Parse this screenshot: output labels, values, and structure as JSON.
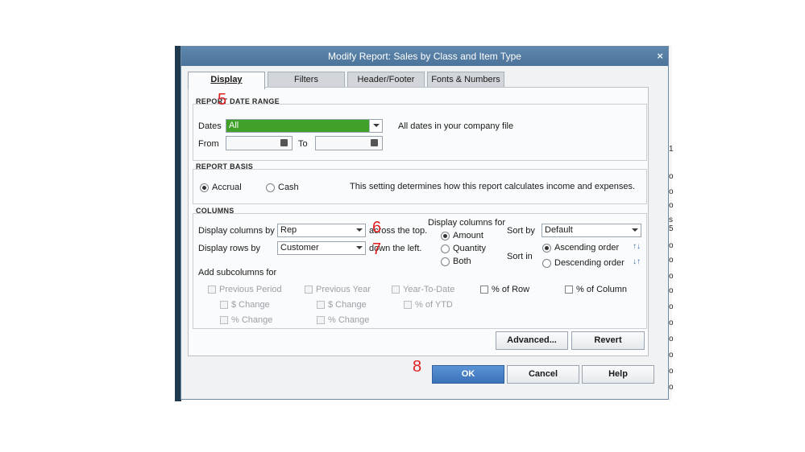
{
  "dialog": {
    "title": "Modify Report: Sales by Class and Item Type",
    "close_glyph": "×"
  },
  "tabs": [
    {
      "label": "Display",
      "active": true
    },
    {
      "label": "Filters",
      "active": false
    },
    {
      "label": "Header/Footer",
      "active": false
    },
    {
      "label": "Fonts & Numbers",
      "active": false
    }
  ],
  "date_range": {
    "section_title": "REPORT DATE RANGE",
    "dates_label": "Dates",
    "dates_value": "All",
    "dates_hint": "All dates in your company file",
    "from_label": "From",
    "to_label": "To",
    "from_value": "",
    "to_value": "",
    "highlight_color": "#3fa12a"
  },
  "basis": {
    "section_title": "REPORT BASIS",
    "accrual_label": "Accrual",
    "cash_label": "Cash",
    "selected": "Accrual",
    "hint": "This setting determines how this report calculates income and expenses."
  },
  "columns": {
    "section_title": "COLUMNS",
    "display_columns_by_label": "Display columns by",
    "display_columns_by_value": "Rep",
    "across_top": "across the top.",
    "display_rows_by_label": "Display rows by",
    "display_rows_by_value": "Customer",
    "down_left": "down the left.",
    "display_columns_for_label": "Display columns for",
    "amount_label": "Amount",
    "quantity_label": "Quantity",
    "both_label": "Both",
    "columns_for_selected": "Amount",
    "sort_by_label": "Sort by",
    "sort_by_value": "Default",
    "sort_in_label": "Sort in",
    "ascending_label": "Ascending order",
    "descending_label": "Descending order",
    "sort_selected": "Ascending order",
    "ascending_icon": "sort-ascending-icon",
    "descending_icon": "sort-descending-icon",
    "add_subcolumns_label": "Add subcolumns for",
    "previous_period": "Previous Period",
    "previous_year": "Previous Year",
    "year_to_date": "Year-To-Date",
    "pct_of_row": "% of Row",
    "pct_of_column": "% of Column",
    "pp_dollar_change": "$ Change",
    "pp_pct_change": "% Change",
    "py_dollar_change": "$ Change",
    "py_pct_change": "% Change",
    "ytd_pct": "% of YTD"
  },
  "buttons": {
    "advanced": "Advanced...",
    "revert": "Revert",
    "ok": "OK",
    "cancel": "Cancel",
    "help": "Help"
  },
  "annotations": {
    "a5": "5",
    "a6": "6",
    "a7": "7",
    "a8": "8",
    "color": "#e02020"
  },
  "background_strip": {
    "chars": [
      "1",
      "o",
      "o",
      "o",
      "s",
      "5",
      "o",
      "o",
      "o",
      "o",
      "o",
      "o",
      "o",
      "o",
      "o",
      "o"
    ]
  }
}
